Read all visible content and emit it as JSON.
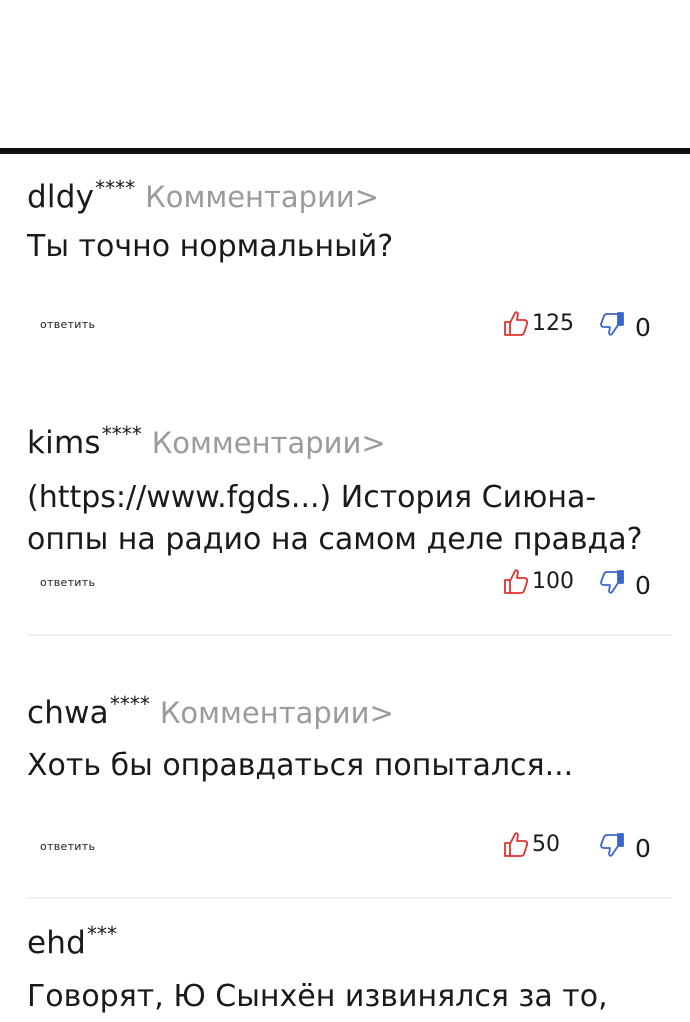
{
  "comments": [
    {
      "author": "dldy",
      "mask": "****",
      "comments_link": "Комментарии>",
      "text": "Ты точно нормальный?",
      "reply": "ответить",
      "likes": "125",
      "dislikes": "0"
    },
    {
      "author": "kims",
      "mask": "****",
      "comments_link": "Комментарии>",
      "text": "(https://www.fgds...) История Сиюна-оппы на радио на самом деле правда?",
      "reply": "ответить",
      "likes": "100",
      "dislikes": "0"
    },
    {
      "author": "chwa",
      "mask": "****",
      "comments_link": "Комментарии>",
      "text": "Хоть бы оправдаться попытался...",
      "reply": "ответить",
      "likes": "50",
      "dislikes": "0"
    },
    {
      "author": "ehd",
      "mask": "***",
      "text": "Говорят, Ю Сынхён извинялся за то,"
    }
  ],
  "icons": {
    "like": "thumbs-up-icon",
    "dislike": "thumbs-down-icon"
  },
  "colors": {
    "like_icon": "#e0322b",
    "dislike_icon": "#3a66c9",
    "muted_text": "#9b9b9b"
  }
}
